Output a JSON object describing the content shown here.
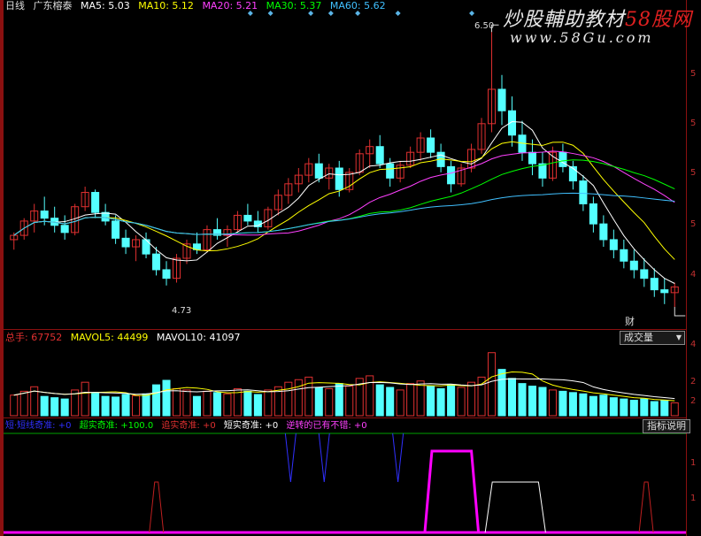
{
  "main_header": {
    "period": "日线",
    "stock": "广东榕泰",
    "ma5": "MA5: 5.03",
    "ma10": "MA10: 5.12",
    "ma20": "MA20: 5.21",
    "ma30": "MA30: 5.37",
    "ma60": "MA60: 5.62"
  },
  "watermark": {
    "line1_a": "炒股輔助教材",
    "line1_b": "58股网",
    "line2": "www.58Gu.com"
  },
  "price_labels": {
    "high": "6.50",
    "low": "4.73"
  },
  "price_axis_ticks": [
    "5",
    "5",
    "5",
    "5",
    "4"
  ],
  "vol_header": {
    "total": "总手: 67752",
    "mavol5": "MAVOL5: 44499",
    "mavol10": "MAVOL10: 41097"
  },
  "vol_axis_ticks": [
    "4",
    "2",
    "2"
  ],
  "ind_header": {
    "a": "短·短线奇准: +0",
    "b": "超实奇准: +100.0",
    "c": "追实奇准: +0",
    "d": "短实奇准: +0",
    "e": "逆转的已有不错: +0"
  },
  "ind_axis_ticks": [
    "1",
    "1"
  ],
  "buttons": {
    "cai": "财",
    "volume": "成交量",
    "indicator_help": "指标说明"
  },
  "colors": {
    "up": "#e03030",
    "down": "#54ffff",
    "ma5": "#ffffff",
    "ma10": "#ffff00",
    "ma20": "#ff40ff",
    "ma30": "#00ff00",
    "ma60": "#40c0ff",
    "ind_magenta": "#ff00ff",
    "ind_white": "#ffffff",
    "ind_red": "#c02020",
    "ind_blue": "#3030ff"
  },
  "chart_data": {
    "type": "candlestick",
    "candles": [
      [
        5.05,
        5.1,
        4.98,
        5.08
      ],
      [
        5.08,
        5.2,
        5.05,
        5.18
      ],
      [
        5.18,
        5.3,
        5.1,
        5.25
      ],
      [
        5.25,
        5.35,
        5.15,
        5.2
      ],
      [
        5.2,
        5.28,
        5.1,
        5.15
      ],
      [
        5.15,
        5.22,
        5.05,
        5.1
      ],
      [
        5.1,
        5.3,
        5.08,
        5.28
      ],
      [
        5.28,
        5.42,
        5.25,
        5.38
      ],
      [
        5.38,
        5.4,
        5.2,
        5.24
      ],
      [
        5.24,
        5.3,
        5.15,
        5.18
      ],
      [
        5.18,
        5.22,
        5.02,
        5.06
      ],
      [
        5.06,
        5.12,
        4.95,
        5.0
      ],
      [
        5.0,
        5.08,
        4.9,
        5.05
      ],
      [
        5.05,
        5.1,
        4.92,
        4.95
      ],
      [
        4.95,
        5.0,
        4.8,
        4.84
      ],
      [
        4.84,
        4.9,
        4.73,
        4.78
      ],
      [
        4.78,
        4.95,
        4.75,
        4.92
      ],
      [
        4.92,
        5.05,
        4.88,
        5.02
      ],
      [
        5.02,
        5.1,
        4.95,
        4.98
      ],
      [
        4.98,
        5.15,
        4.96,
        5.12
      ],
      [
        5.12,
        5.2,
        5.05,
        5.08
      ],
      [
        5.08,
        5.15,
        5.0,
        5.12
      ],
      [
        5.12,
        5.25,
        5.1,
        5.22
      ],
      [
        5.22,
        5.3,
        5.15,
        5.18
      ],
      [
        5.18,
        5.25,
        5.1,
        5.14
      ],
      [
        5.14,
        5.28,
        5.12,
        5.26
      ],
      [
        5.26,
        5.4,
        5.22,
        5.36
      ],
      [
        5.36,
        5.48,
        5.3,
        5.44
      ],
      [
        5.44,
        5.55,
        5.38,
        5.5
      ],
      [
        5.5,
        5.62,
        5.45,
        5.58
      ],
      [
        5.58,
        5.65,
        5.45,
        5.48
      ],
      [
        5.48,
        5.58,
        5.4,
        5.55
      ],
      [
        5.55,
        5.6,
        5.35,
        5.4
      ],
      [
        5.4,
        5.55,
        5.38,
        5.52
      ],
      [
        5.52,
        5.68,
        5.5,
        5.65
      ],
      [
        5.65,
        5.75,
        5.55,
        5.7
      ],
      [
        5.7,
        5.78,
        5.55,
        5.58
      ],
      [
        5.58,
        5.62,
        5.42,
        5.48
      ],
      [
        5.48,
        5.6,
        5.45,
        5.57
      ],
      [
        5.57,
        5.7,
        5.55,
        5.66
      ],
      [
        5.66,
        5.8,
        5.6,
        5.76
      ],
      [
        5.76,
        5.82,
        5.62,
        5.66
      ],
      [
        5.66,
        5.72,
        5.52,
        5.56
      ],
      [
        5.56,
        5.6,
        5.38,
        5.44
      ],
      [
        5.44,
        5.58,
        5.42,
        5.55
      ],
      [
        5.55,
        5.72,
        5.52,
        5.68
      ],
      [
        5.68,
        5.9,
        5.65,
        5.86
      ],
      [
        5.86,
        6.5,
        5.8,
        6.1
      ],
      [
        6.1,
        6.2,
        5.85,
        5.95
      ],
      [
        5.95,
        6.05,
        5.7,
        5.78
      ],
      [
        5.78,
        5.88,
        5.6,
        5.66
      ],
      [
        5.66,
        5.75,
        5.5,
        5.58
      ],
      [
        5.58,
        5.66,
        5.42,
        5.48
      ],
      [
        5.48,
        5.7,
        5.46,
        5.66
      ],
      [
        5.66,
        5.72,
        5.52,
        5.56
      ],
      [
        5.56,
        5.6,
        5.4,
        5.46
      ],
      [
        5.46,
        5.5,
        5.25,
        5.3
      ],
      [
        5.3,
        5.35,
        5.1,
        5.16
      ],
      [
        5.16,
        5.22,
        5.0,
        5.05
      ],
      [
        5.05,
        5.12,
        4.92,
        4.98
      ],
      [
        4.98,
        5.05,
        4.85,
        4.9
      ],
      [
        4.9,
        4.98,
        4.78,
        4.84
      ],
      [
        4.84,
        4.92,
        4.72,
        4.78
      ],
      [
        4.78,
        4.85,
        4.65,
        4.7
      ],
      [
        4.7,
        4.78,
        4.6,
        4.68
      ],
      [
        4.68,
        4.75,
        4.58,
        4.72
      ]
    ],
    "volumes": [
      32,
      38,
      45,
      30,
      28,
      26,
      40,
      52,
      35,
      30,
      29,
      33,
      31,
      34,
      48,
      55,
      42,
      40,
      30,
      38,
      36,
      34,
      42,
      38,
      33,
      40,
      45,
      52,
      56,
      60,
      44,
      42,
      50,
      46,
      58,
      62,
      48,
      44,
      40,
      50,
      54,
      46,
      42,
      48,
      44,
      52,
      60,
      98,
      72,
      58,
      50,
      46,
      44,
      40,
      38,
      36,
      34,
      30,
      32,
      28,
      26,
      24,
      26,
      22,
      24,
      20
    ],
    "indicator": {
      "magenta_block": [
        0.62,
        0.7
      ],
      "white_block": [
        0.71,
        0.8
      ],
      "red_pulses": [
        0.22,
        0.95
      ],
      "blue_spikes": [
        0.42,
        0.47,
        0.58
      ]
    },
    "ylim_price": [
      4.5,
      6.6
    ],
    "ylim_volume": [
      0,
      110
    ]
  }
}
